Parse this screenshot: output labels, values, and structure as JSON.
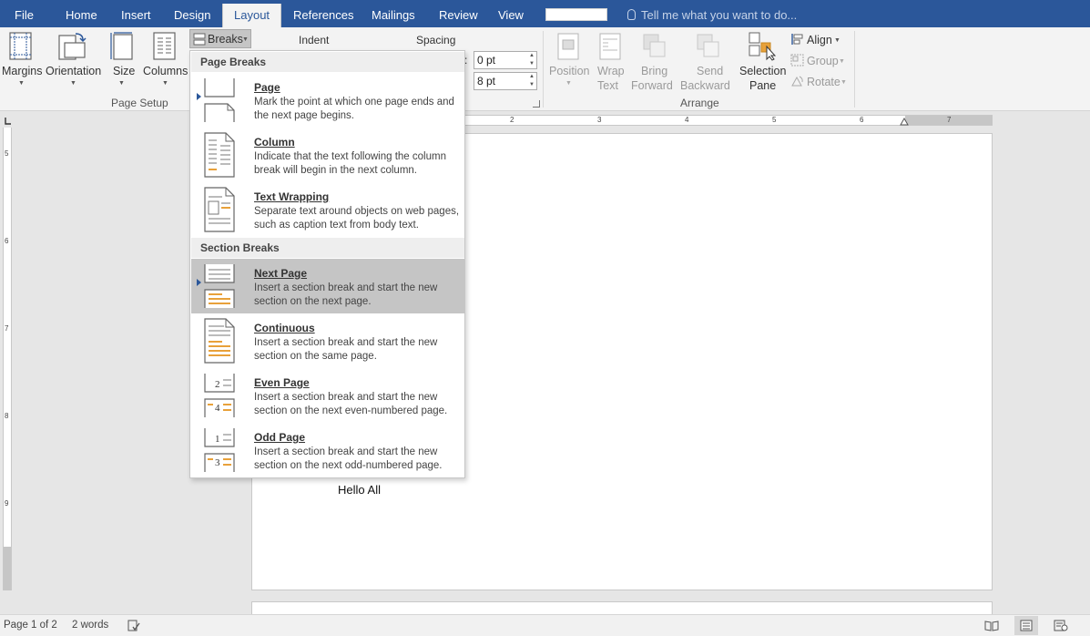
{
  "tabs": {
    "file": "File",
    "home": "Home",
    "insert": "Insert",
    "design": "Design",
    "layout": "Layout",
    "references": "References",
    "mailings": "Mailings",
    "review": "Review",
    "view": "View"
  },
  "tell_me": "Tell me what you want to do...",
  "ribbon": {
    "page_setup": {
      "margins": "Margins",
      "orientation": "Orientation",
      "size": "Size",
      "columns": "Columns",
      "breaks": "Breaks",
      "group_label": "Page Setup"
    },
    "paragraph": {
      "indent_label": "Indent",
      "spacing_label": "Spacing",
      "spacing_before": "0 pt",
      "spacing_after": "8 pt"
    },
    "arrange": {
      "position": "Position",
      "wrap_1": "Wrap",
      "wrap_2": "Text",
      "bring_1": "Bring",
      "bring_2": "Forward",
      "send_1": "Send",
      "send_2": "Backward",
      "selection_1": "Selection",
      "selection_2": "Pane",
      "align": "Align",
      "group": "Group",
      "rotate": "Rotate",
      "group_label": "Arrange"
    }
  },
  "ruler": {
    "h_numbers": [
      "2",
      "3",
      "4",
      "5",
      "6",
      "7"
    ],
    "v_numbers": [
      "5",
      "6",
      "7",
      "8",
      "9"
    ]
  },
  "breaks_menu": {
    "page_breaks_header": "Page Breaks",
    "section_breaks_header": "Section Breaks",
    "items": [
      {
        "title": "Page",
        "desc": "Mark the point at which one page ends and the next page begins."
      },
      {
        "title": "Column",
        "desc": "Indicate that the text following the column break will begin in the next column."
      },
      {
        "title": "Text Wrapping",
        "desc": "Separate text around objects on web pages, such as caption text from body text."
      },
      {
        "title": "Next Page",
        "desc": "Insert a section break and start the new section on the next page."
      },
      {
        "title": "Continuous",
        "desc": "Insert a section break and start the new section on the same page."
      },
      {
        "title": "Even Page",
        "desc": "Insert a section break and start the new section on the next even-numbered page."
      },
      {
        "title": "Odd Page",
        "desc": "Insert a section break and start the new section on the next odd-numbered page."
      }
    ],
    "highlighted_index": 3,
    "icon_digits": {
      "even_top": "2",
      "even_bottom": "4",
      "odd_top": "1",
      "odd_bottom": "3"
    }
  },
  "document": {
    "text": "Hello All"
  },
  "status_bar": {
    "page": "Page 1 of 2",
    "words": "2 words"
  },
  "colors": {
    "accent": "#2b579a",
    "orange": "#e8a13a",
    "highlight": "#c5c5c5"
  }
}
